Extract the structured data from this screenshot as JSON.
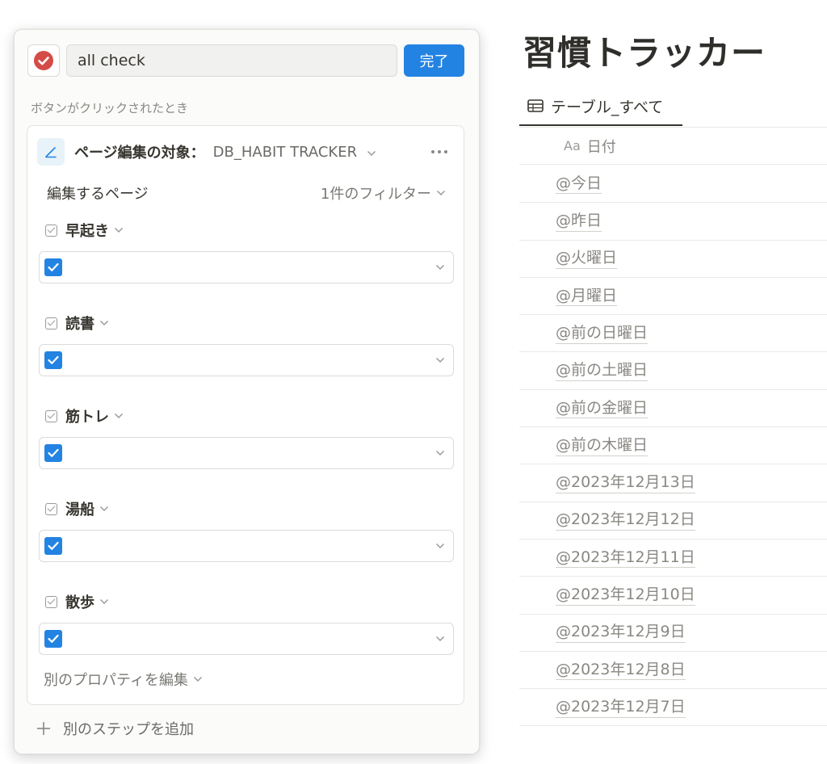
{
  "page": {
    "title": "習慣トラッカー",
    "view_tab": {
      "label": "テーブル_すべて",
      "icon": "table-icon"
    },
    "column_header": {
      "icon_text": "Aa",
      "label": "日付"
    },
    "rows": [
      "@今日",
      "@昨日",
      "@火曜日",
      "@月曜日",
      "@前の日曜日",
      "@前の土曜日",
      "@前の金曜日",
      "@前の木曜日",
      "@2023年12月13日",
      "@2023年12月12日",
      "@2023年12月11日",
      "@2023年12月10日",
      "@2023年12月9日",
      "@2023年12月8日",
      "@2023年12月7日"
    ]
  },
  "panel": {
    "button_icon": "red-checkmark-icon",
    "button_name": "all check",
    "done_label": "完了",
    "trigger_label": "ボタンがクリックされたとき",
    "step": {
      "icon": "pencil-icon",
      "title": "ページ編集の対象：",
      "database": "DB_HABIT TRACKER",
      "pages_label": "編集するページ",
      "filter_label": "1件のフィルター",
      "properties": [
        {
          "name": "早起き",
          "value": "checked"
        },
        {
          "name": "読書",
          "value": "checked"
        },
        {
          "name": "筋トレ",
          "value": "checked"
        },
        {
          "name": "湯船",
          "value": "checked"
        },
        {
          "name": "散歩",
          "value": "checked"
        }
      ],
      "edit_other_label": "別のプロパティを編集"
    },
    "add_step_label": "別のステップを追加"
  },
  "colors": {
    "accent": "#2383e2",
    "icon_red": "#d44c47",
    "text": "#37352f",
    "muted": "#8a8883"
  }
}
